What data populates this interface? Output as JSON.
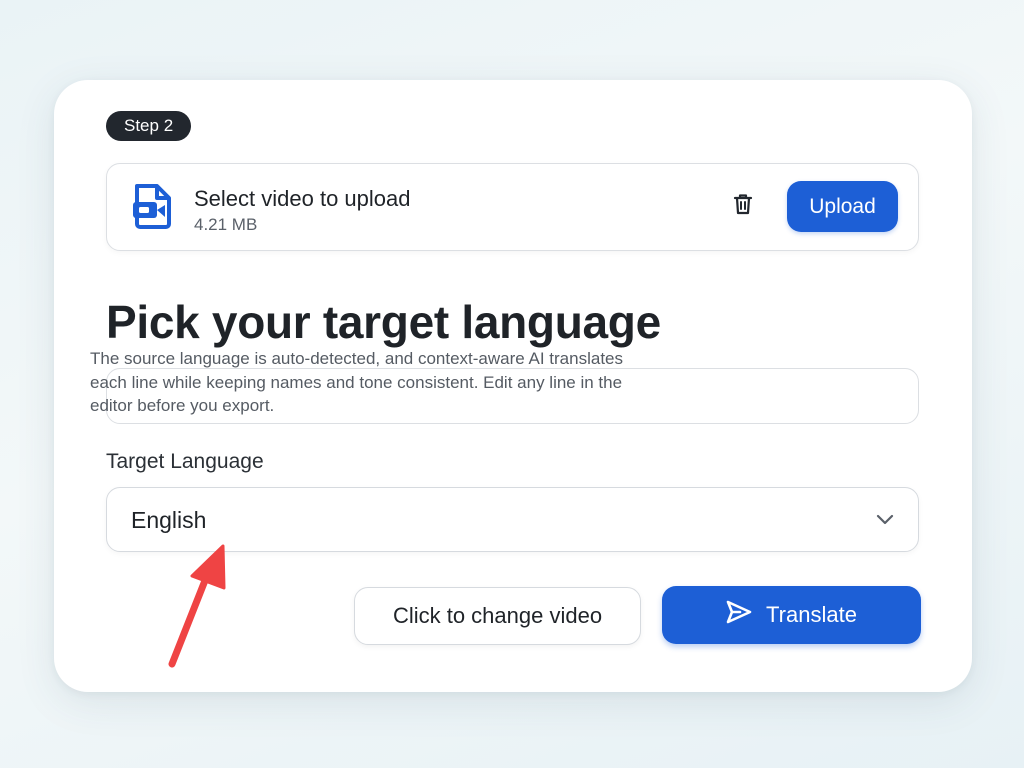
{
  "step": {
    "label": "Step 2"
  },
  "upload": {
    "file_title": "Select video to upload",
    "file_size": "4.21 MB",
    "upload_label": "Upload",
    "icons": {
      "file": "video-file-icon",
      "delete": "trash-icon"
    }
  },
  "main": {
    "heading": "Pick your target language",
    "description": "The source language is auto-detected, and context-aware AI translates each line while keeping names and tone consistent. Edit any line in the editor before you export."
  },
  "target_language": {
    "label": "Target Language",
    "selected": "English",
    "icon": "chevron-down-icon"
  },
  "actions": {
    "change_video_label": "Click to change video",
    "translate_label": "Translate",
    "translate_icon": "send-icon"
  },
  "annotation": {
    "icon": "red-arrow-annotation",
    "color": "#ef4444"
  },
  "colors": {
    "accent": "#1d5fd6",
    "pill": "#22272e"
  }
}
